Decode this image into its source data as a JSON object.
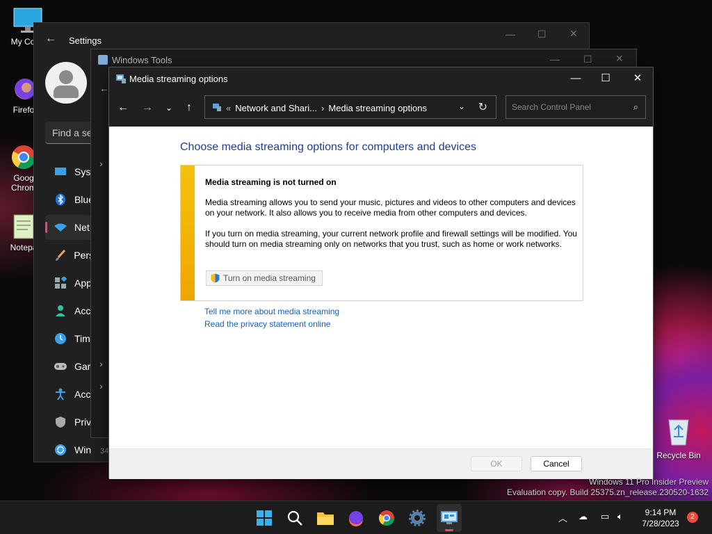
{
  "desktop": {
    "icons": [
      {
        "label": "My Com"
      },
      {
        "label": "Firefo"
      },
      {
        "label": "Goog"
      },
      {
        "label": "Chrom"
      },
      {
        "label": "Notepa"
      }
    ],
    "recycle_bin": "Recycle Bin",
    "watermark_line1": "Windows 11 Pro Insider Preview",
    "watermark_line2": "Evaluation copy. Build 25375.zn_release.230520-1632"
  },
  "settings": {
    "title": "Settings",
    "search_placeholder": "Find a se",
    "nav": [
      {
        "label": "Syst",
        "icon": "monitor-icon"
      },
      {
        "label": "Blue",
        "icon": "bluetooth-icon"
      },
      {
        "label": "Net",
        "icon": "wifi-icon"
      },
      {
        "label": "Pers",
        "icon": "brush-icon"
      },
      {
        "label": "App",
        "icon": "apps-icon"
      },
      {
        "label": "Acc",
        "icon": "person-icon"
      },
      {
        "label": "Tim",
        "icon": "clock-icon"
      },
      {
        "label": "Gar",
        "icon": "gamepad-icon"
      },
      {
        "label": "Acc",
        "icon": "accessibility-icon"
      },
      {
        "label": "Priv",
        "icon": "shield-icon"
      },
      {
        "label": "Win",
        "icon": "update-icon"
      }
    ],
    "footer": "34"
  },
  "windows_tools": {
    "title": "Windows Tools"
  },
  "media_window": {
    "title": "Media streaming options",
    "breadcrumb_sep": "«",
    "breadcrumb_parent": "Network and Shari...",
    "breadcrumb_arrow": "›",
    "breadcrumb_current": "Media streaming options",
    "search_placeholder": "Search Control Panel",
    "heading": "Choose media streaming options for computers and devices",
    "panel_title": "Media streaming is not turned on",
    "panel_p1": "Media streaming allows you to send your music, pictures and videos to other computers and devices on your network.  It also allows you to receive media from other computers and devices.",
    "panel_p2": "If you turn on media streaming, your current network profile and firewall settings will be modified. You should turn on media streaming only on networks that you trust, such as home or work networks.",
    "turn_on_button": "Turn on media streaming",
    "link1": "Tell me more about media streaming",
    "link2": "Read the privacy statement online",
    "ok": "OK",
    "cancel": "Cancel"
  },
  "taskbar": {
    "time": "9:14 PM",
    "date": "7/28/2023",
    "notifications": "2"
  },
  "colors": {
    "accent": "#e8457a",
    "link": "#1a5fb4",
    "heading": "#1e3d8f",
    "warning_strip": "#f4c20d"
  }
}
